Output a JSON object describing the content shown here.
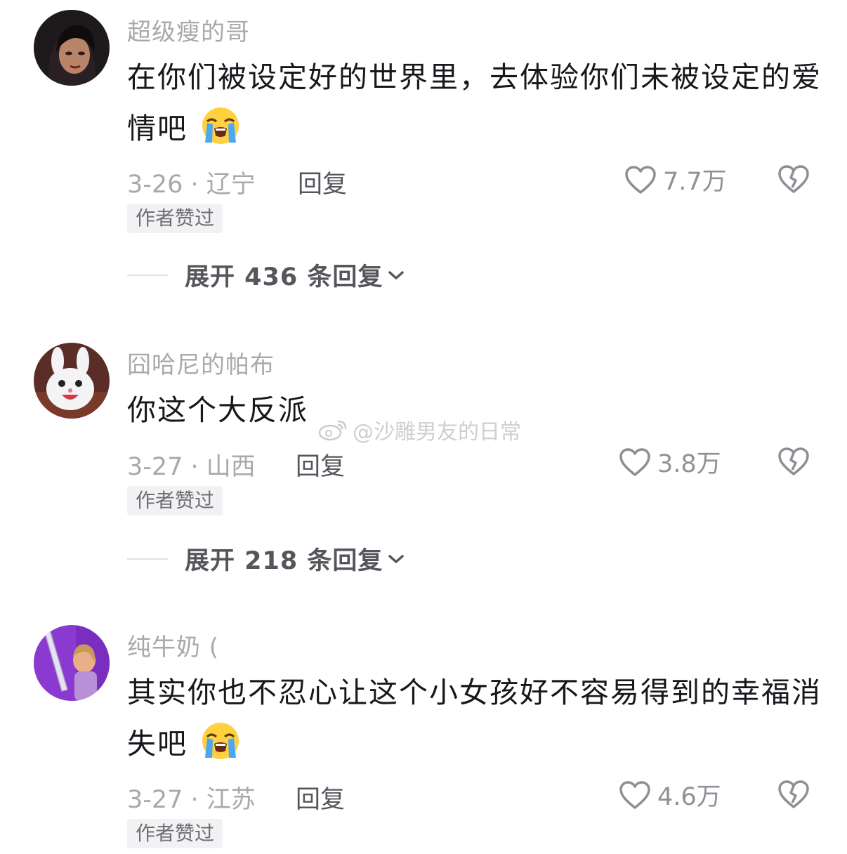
{
  "comments": [
    {
      "username": "超级瘦的哥",
      "text": "在你们被设定好的世界里，去体验你们未被设定的爱情吧",
      "emoji": "loudly-crying-face",
      "date_location": "3-26 · 辽宁",
      "reply_label": "回复",
      "likes": "7.7万",
      "badge": "作者赞过",
      "expand_label": "展开 436 条回复"
    },
    {
      "username": "囧哈尼的帕布",
      "text": "你这个大反派",
      "emoji": "",
      "date_location": "3-27 · 山西",
      "reply_label": "回复",
      "likes": "3.8万",
      "badge": "作者赞过",
      "expand_label": "展开 218 条回复"
    },
    {
      "username": "纯牛奶 (",
      "text": "其实你也不忍心让这个小女孩好不容易得到的幸福消失吧",
      "emoji": "loudly-crying-face",
      "date_location": "3-27 · 江苏",
      "reply_label": "回复",
      "likes": "4.6万",
      "badge": "作者赞过"
    }
  ],
  "watermark": "@沙雕男友的日常",
  "icons": {
    "like": "heart-outline-icon",
    "dislike": "broken-heart-icon",
    "expand": "chevron-down-icon",
    "watermark": "weibo-logo-icon"
  },
  "colors": {
    "text": "#17171c",
    "muted": "#a9a9ad",
    "badge_bg": "#f2f2f4",
    "icon": "#909096"
  }
}
